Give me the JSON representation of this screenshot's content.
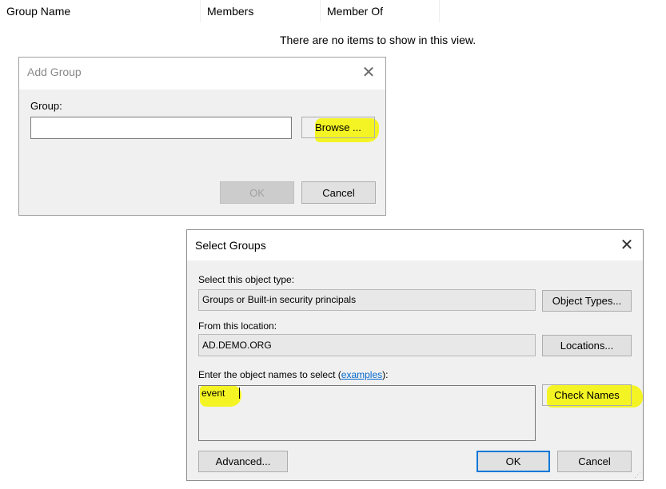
{
  "list": {
    "columns": [
      "Group Name",
      "Members",
      "Member Of"
    ],
    "empty_message": "There are no items to show in this view."
  },
  "add_group_dialog": {
    "title": "Add Group",
    "group_label": "Group:",
    "group_value": "",
    "browse_label": "Browse ...",
    "ok_label": "OK",
    "cancel_label": "Cancel"
  },
  "select_groups_dialog": {
    "title": "Select Groups",
    "object_type_label": "Select this object type:",
    "object_type_value": "Groups or Built-in security principals",
    "object_types_button": "Object Types...",
    "location_label": "From this location:",
    "location_value": "AD.DEMO.ORG",
    "locations_button": "Locations...",
    "names_label_prefix": "Enter the object names to select (",
    "names_label_link": "examples",
    "names_label_suffix": "):",
    "names_value": "event",
    "check_names_button": "Check Names",
    "advanced_button": "Advanced...",
    "ok_label": "OK",
    "cancel_label": "Cancel"
  },
  "colors": {
    "highlight": "#f4f400",
    "link": "#0066cc",
    "default_button_border": "#0078d7",
    "dialog_background": "#f0f0f0"
  },
  "icons": {
    "sort": "sort-caret-icon",
    "close": "close-icon",
    "resize": "resize-grip-icon"
  }
}
